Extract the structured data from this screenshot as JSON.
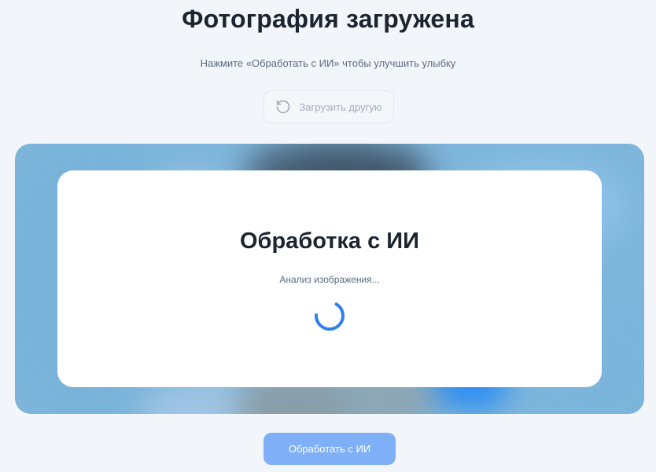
{
  "header": {
    "title": "Фотография загружена",
    "subtitle": "Нажмите «Обработать с ИИ» чтобы улучшить улыбку"
  },
  "reupload_button": {
    "label": "Загрузить другую",
    "icon": "rotate-ccw-icon"
  },
  "processing_overlay": {
    "title": "Обработка с ИИ",
    "status": "Анализ изображения...",
    "spinner_icon": "loading-spinner-icon"
  },
  "process_button": {
    "label": "Обработать с ИИ"
  },
  "colors": {
    "background": "#f2f5f9",
    "photo_frame": "#7fb6db",
    "spinner": "#2f80ed",
    "primary_button": "#7fb0f7",
    "heading_text": "#1c2430",
    "muted_text": "#5c6b80"
  }
}
